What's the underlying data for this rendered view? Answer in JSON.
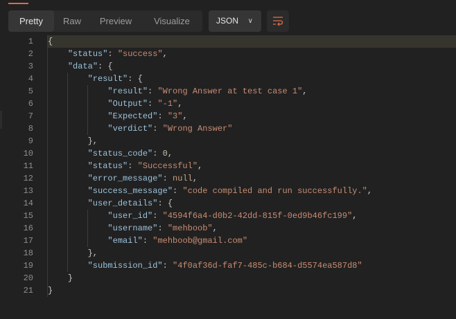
{
  "tabs": [
    {
      "label": "Pretty",
      "active": true
    },
    {
      "label": "Raw",
      "active": false
    },
    {
      "label": "Preview",
      "active": false
    },
    {
      "label": "Visualize",
      "active": false
    }
  ],
  "format_select": {
    "value": "JSON",
    "icon": "chevron-down-icon"
  },
  "wrap_button": {
    "icon": "wrap-lines-icon",
    "color": "#e06c4b"
  },
  "colors": {
    "key": "#9cc3dc",
    "string": "#c98d73",
    "number": "#b8c8b0",
    "null": "#c99f7f",
    "background": "#212121"
  },
  "lines": [
    {
      "indent": 0,
      "tokens": [
        [
          "p",
          "{"
        ]
      ]
    },
    {
      "indent": 1,
      "tokens": [
        [
          "k",
          "\"status\""
        ],
        [
          "p",
          ": "
        ],
        [
          "s",
          "\"success\""
        ],
        [
          "p",
          ","
        ]
      ]
    },
    {
      "indent": 1,
      "tokens": [
        [
          "k",
          "\"data\""
        ],
        [
          "p",
          ": {"
        ]
      ]
    },
    {
      "indent": 2,
      "tokens": [
        [
          "k",
          "\"result\""
        ],
        [
          "p",
          ": {"
        ]
      ]
    },
    {
      "indent": 3,
      "tokens": [
        [
          "k",
          "\"result\""
        ],
        [
          "p",
          ": "
        ],
        [
          "s",
          "\"Wrong Answer at test case 1\""
        ],
        [
          "p",
          ","
        ]
      ]
    },
    {
      "indent": 3,
      "tokens": [
        [
          "k",
          "\"Output\""
        ],
        [
          "p",
          ": "
        ],
        [
          "s",
          "\"-1\""
        ],
        [
          "p",
          ","
        ]
      ]
    },
    {
      "indent": 3,
      "tokens": [
        [
          "k",
          "\"Expected\""
        ],
        [
          "p",
          ": "
        ],
        [
          "s",
          "\"3\""
        ],
        [
          "p",
          ","
        ]
      ]
    },
    {
      "indent": 3,
      "tokens": [
        [
          "k",
          "\"verdict\""
        ],
        [
          "p",
          ": "
        ],
        [
          "s",
          "\"Wrong Answer\""
        ]
      ]
    },
    {
      "indent": 2,
      "tokens": [
        [
          "p",
          "},"
        ]
      ]
    },
    {
      "indent": 2,
      "tokens": [
        [
          "k",
          "\"status_code\""
        ],
        [
          "p",
          ": "
        ],
        [
          "n",
          "0"
        ],
        [
          "p",
          ","
        ]
      ]
    },
    {
      "indent": 2,
      "tokens": [
        [
          "k",
          "\"status\""
        ],
        [
          "p",
          ": "
        ],
        [
          "s",
          "\"Successful\""
        ],
        [
          "p",
          ","
        ]
      ]
    },
    {
      "indent": 2,
      "tokens": [
        [
          "k",
          "\"error_message\""
        ],
        [
          "p",
          ": "
        ],
        [
          "nl",
          "null"
        ],
        [
          "p",
          ","
        ]
      ]
    },
    {
      "indent": 2,
      "tokens": [
        [
          "k",
          "\"success_message\""
        ],
        [
          "p",
          ": "
        ],
        [
          "s",
          "\"code compiled and run successfully.\""
        ],
        [
          "p",
          ","
        ]
      ]
    },
    {
      "indent": 2,
      "tokens": [
        [
          "k",
          "\"user_details\""
        ],
        [
          "p",
          ": {"
        ]
      ]
    },
    {
      "indent": 3,
      "tokens": [
        [
          "k",
          "\"user_id\""
        ],
        [
          "p",
          ": "
        ],
        [
          "s",
          "\"4594f6a4-d0b2-42dd-815f-0ed9b46fc199\""
        ],
        [
          "p",
          ","
        ]
      ]
    },
    {
      "indent": 3,
      "tokens": [
        [
          "k",
          "\"username\""
        ],
        [
          "p",
          ": "
        ],
        [
          "s",
          "\"mehboob\""
        ],
        [
          "p",
          ","
        ]
      ]
    },
    {
      "indent": 3,
      "tokens": [
        [
          "k",
          "\"email\""
        ],
        [
          "p",
          ": "
        ],
        [
          "s",
          "\"mehboob@gmail.com\""
        ]
      ]
    },
    {
      "indent": 2,
      "tokens": [
        [
          "p",
          "},"
        ]
      ]
    },
    {
      "indent": 2,
      "tokens": [
        [
          "k",
          "\"submission_id\""
        ],
        [
          "p",
          ": "
        ],
        [
          "s",
          "\"4f0af36d-faf7-485c-b684-d5574ea587d8\""
        ]
      ]
    },
    {
      "indent": 1,
      "tokens": [
        [
          "p",
          "}"
        ]
      ]
    },
    {
      "indent": 0,
      "tokens": [
        [
          "p",
          "}"
        ]
      ]
    }
  ]
}
